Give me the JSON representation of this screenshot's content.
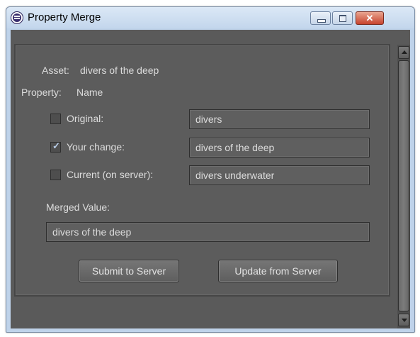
{
  "window": {
    "title": "Property Merge",
    "close_glyph": "✕",
    "icons": {
      "app": "app-icon",
      "minimize": "minimize-icon",
      "maximize": "maximize-icon",
      "close": "close-icon"
    }
  },
  "asset": {
    "label": "Asset:",
    "value": "divers of the deep"
  },
  "property": {
    "label": "Property:",
    "value": "Name"
  },
  "options": [
    {
      "label": "Original:",
      "checked": false,
      "value": "divers"
    },
    {
      "label": "Your change:",
      "checked": true,
      "value": "divers of the deep"
    },
    {
      "label": "Current (on server):",
      "checked": false,
      "value": "divers underwater"
    }
  ],
  "check_glyph": "✓",
  "merged": {
    "label": "Merged Value:",
    "value": "divers of the deep"
  },
  "buttons": {
    "submit": "Submit to Server",
    "update": "Update from Server"
  },
  "colors": {
    "panel_bg": "#5c5c5c",
    "text": "#dcdcdc",
    "titlebar": "#c3d6ec",
    "close_button": "#c7432e"
  }
}
